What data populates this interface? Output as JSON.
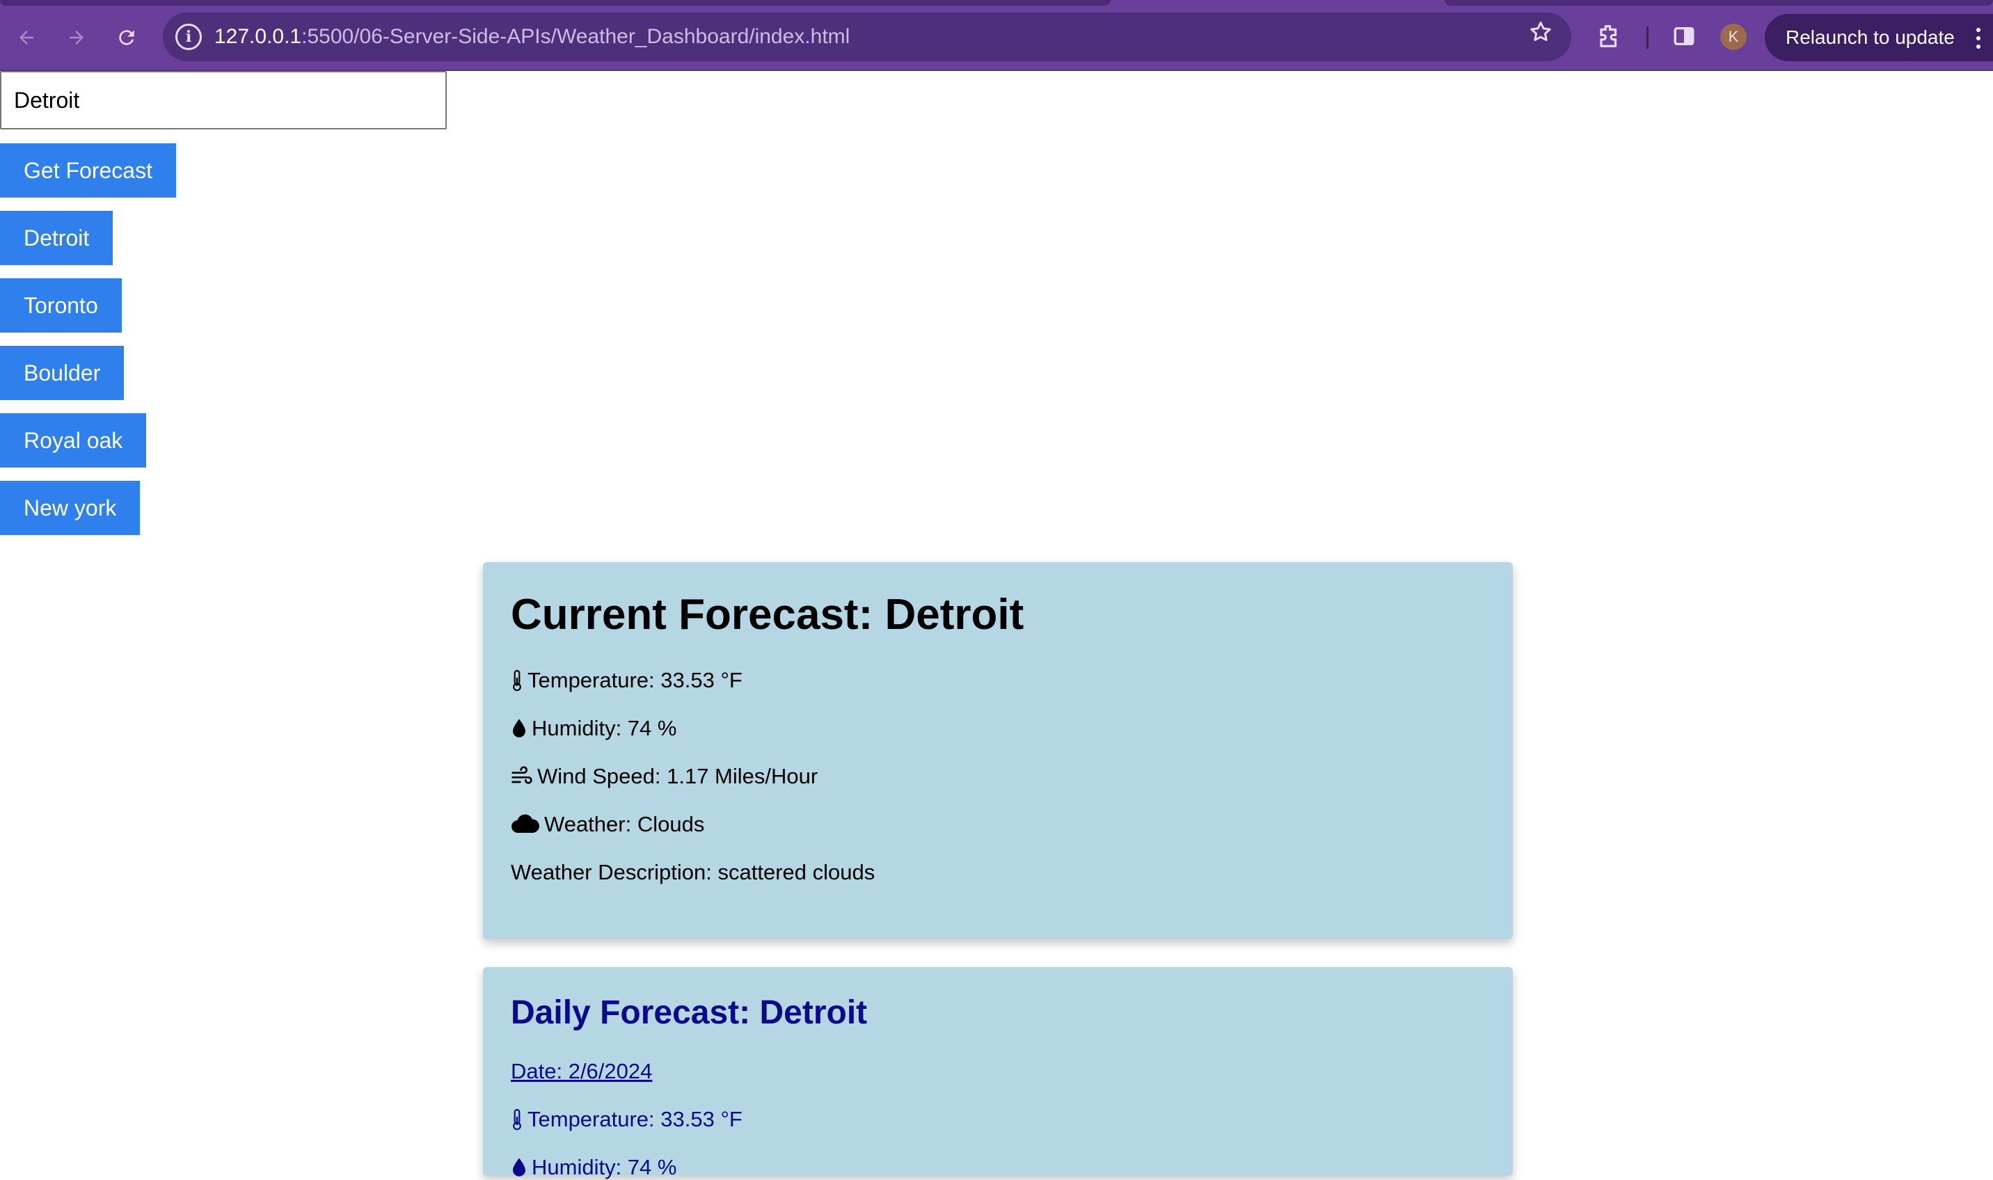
{
  "browser": {
    "url_host": "127.0.0.1",
    "url_rest": ":5500/06-Server-Side-APIs/Weather_Dashboard/index.html",
    "profile_initial": "K",
    "relaunch_label": "Relaunch to update",
    "theme_color": "#6a3f9c"
  },
  "search": {
    "value": "Detroit",
    "submit_label": "Get Forecast"
  },
  "history": [
    {
      "label": "Detroit"
    },
    {
      "label": "Toronto"
    },
    {
      "label": "Boulder"
    },
    {
      "label": "Royal oak"
    },
    {
      "label": "New york"
    }
  ],
  "current": {
    "title": "Current Forecast: Detroit",
    "temperature": "Temperature: 33.53 °F",
    "humidity": "Humidity: 74 %",
    "wind": "Wind Speed: 1.17 Miles/Hour",
    "weather": "Weather: Clouds",
    "description": "Weather Description: scattered clouds"
  },
  "daily": {
    "title": "Daily Forecast: Detroit",
    "date": "Date: 2/6/2024",
    "temperature": "Temperature: 33.53 °F",
    "humidity": "Humidity: 74 %"
  },
  "colors": {
    "button": "#2f80ed",
    "card": "#b5d7e3",
    "daily_text": "#0a0a8a"
  },
  "icons": {
    "temperature": "thermometer-icon",
    "humidity": "droplet-icon",
    "wind": "wind-icon",
    "weather": "cloud-icon"
  }
}
